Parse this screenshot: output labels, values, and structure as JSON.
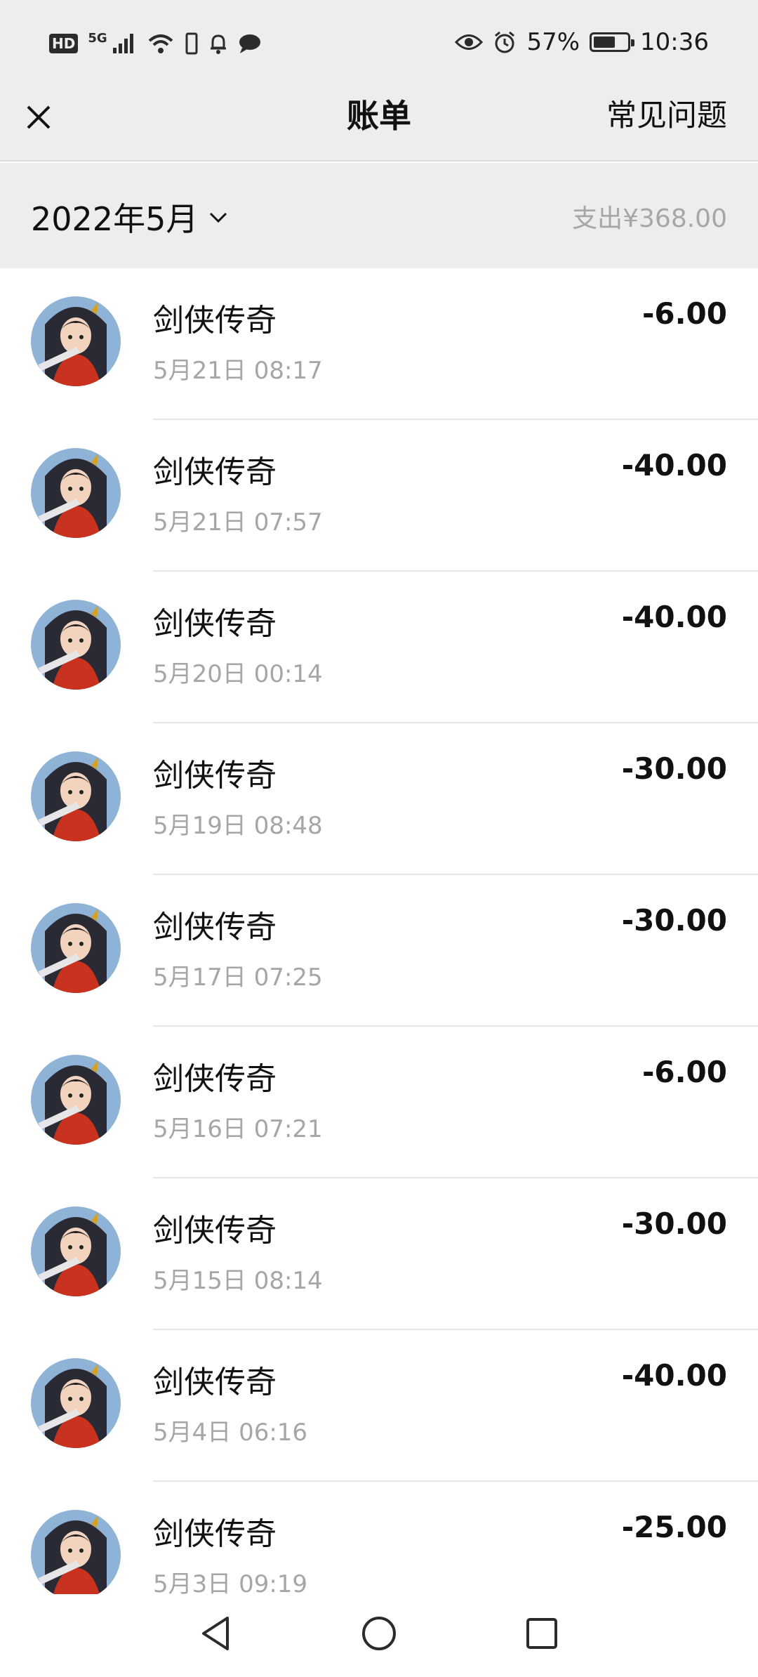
{
  "status_bar": {
    "hd": "HD",
    "network": "5G",
    "battery_percent_text": "57%",
    "battery_level": 0.57,
    "time": "10:36",
    "icons": [
      "hd-icon",
      "signal-icon",
      "wifi-icon",
      "phone-icon",
      "bell-icon",
      "message-icon",
      "eye-icon",
      "alarm-icon",
      "battery-icon"
    ]
  },
  "header": {
    "title": "账单",
    "faq_label": "常见问题",
    "close_icon": "close-icon"
  },
  "filter": {
    "month": "2022年5月",
    "expense_label": "支出¥368.00"
  },
  "transactions": [
    {
      "name": "剑侠传奇",
      "time": "5月21日 08:17",
      "amount": "-6.00"
    },
    {
      "name": "剑侠传奇",
      "time": "5月21日 07:57",
      "amount": "-40.00"
    },
    {
      "name": "剑侠传奇",
      "time": "5月20日 00:14",
      "amount": "-40.00"
    },
    {
      "name": "剑侠传奇",
      "time": "5月19日 08:48",
      "amount": "-30.00"
    },
    {
      "name": "剑侠传奇",
      "time": "5月17日 07:25",
      "amount": "-30.00"
    },
    {
      "name": "剑侠传奇",
      "time": "5月16日 07:21",
      "amount": "-6.00"
    },
    {
      "name": "剑侠传奇",
      "time": "5月15日 08:14",
      "amount": "-30.00"
    },
    {
      "name": "剑侠传奇",
      "time": "5月4日 06:16",
      "amount": "-40.00"
    },
    {
      "name": "剑侠传奇",
      "time": "5月3日 09:19",
      "amount": "-25.00"
    }
  ],
  "nav": {
    "icons": [
      "back-icon",
      "home-icon",
      "recents-icon"
    ]
  },
  "colors": {
    "background_gray": "#ededed",
    "secondary_text": "#a6a6a6",
    "primary_text": "#111111"
  }
}
